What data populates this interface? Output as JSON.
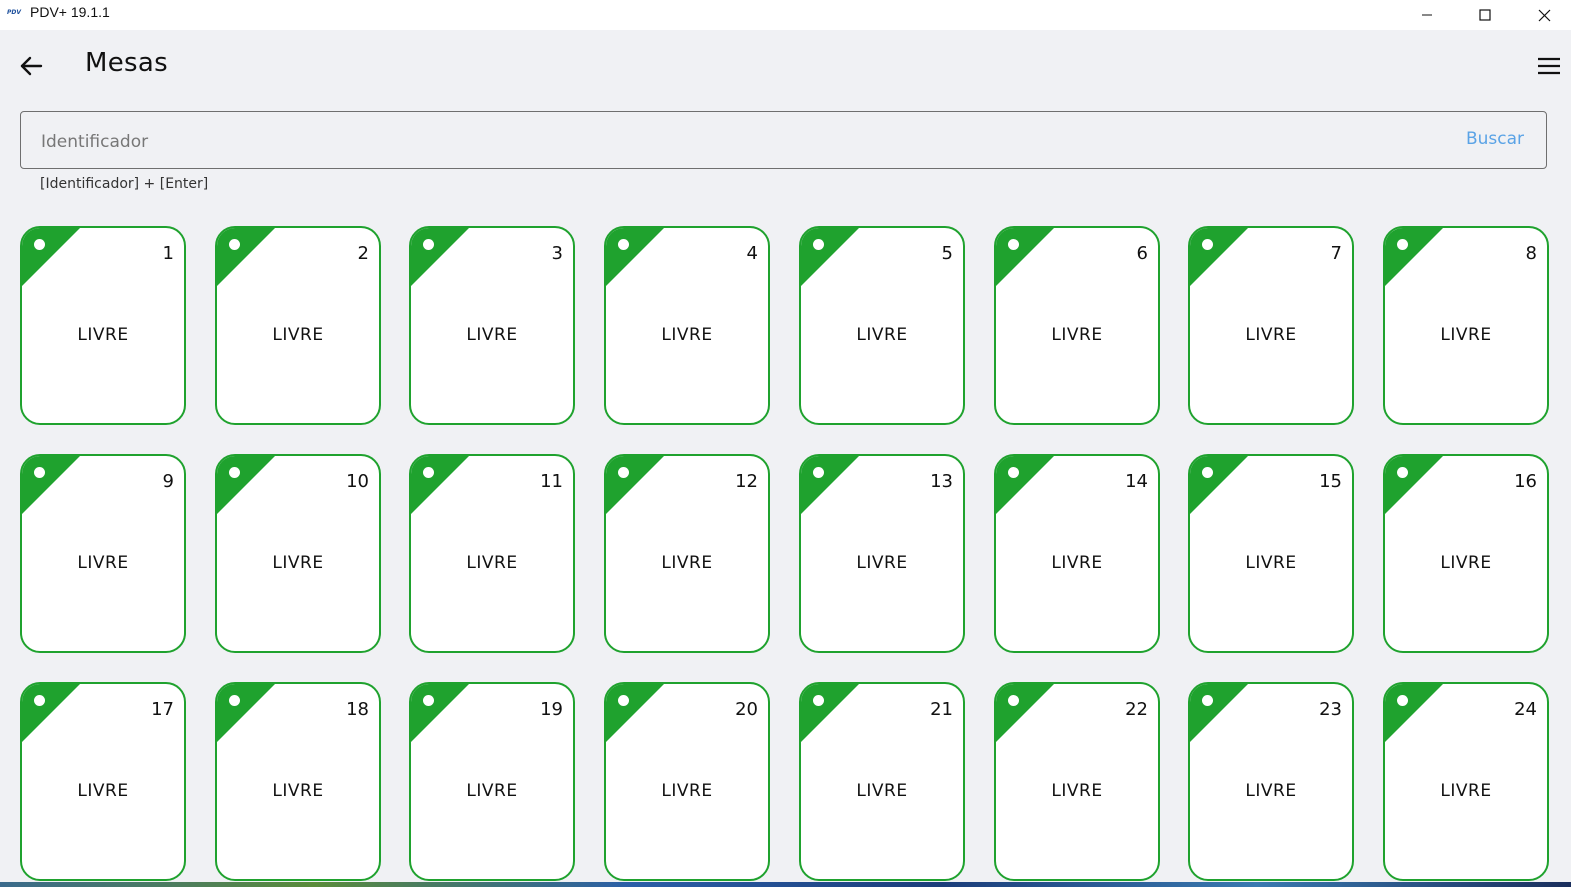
{
  "window": {
    "logo_text": "PDV",
    "title": "PDV+ 19.1.1"
  },
  "header": {
    "title": "Mesas"
  },
  "search": {
    "placeholder": "Identificador",
    "value": "",
    "button_label": "Buscar",
    "hint": "[Identificador] + [Enter]"
  },
  "colors": {
    "free_status": "#1fa22e",
    "search_button": "#5aa3e6",
    "background": "#f0f1f4"
  },
  "tables": [
    {
      "number": "1",
      "status": "LIVRE"
    },
    {
      "number": "2",
      "status": "LIVRE"
    },
    {
      "number": "3",
      "status": "LIVRE"
    },
    {
      "number": "4",
      "status": "LIVRE"
    },
    {
      "number": "5",
      "status": "LIVRE"
    },
    {
      "number": "6",
      "status": "LIVRE"
    },
    {
      "number": "7",
      "status": "LIVRE"
    },
    {
      "number": "8",
      "status": "LIVRE"
    },
    {
      "number": "9",
      "status": "LIVRE"
    },
    {
      "number": "10",
      "status": "LIVRE"
    },
    {
      "number": "11",
      "status": "LIVRE"
    },
    {
      "number": "12",
      "status": "LIVRE"
    },
    {
      "number": "13",
      "status": "LIVRE"
    },
    {
      "number": "14",
      "status": "LIVRE"
    },
    {
      "number": "15",
      "status": "LIVRE"
    },
    {
      "number": "16",
      "status": "LIVRE"
    },
    {
      "number": "17",
      "status": "LIVRE"
    },
    {
      "number": "18",
      "status": "LIVRE"
    },
    {
      "number": "19",
      "status": "LIVRE"
    },
    {
      "number": "20",
      "status": "LIVRE"
    },
    {
      "number": "21",
      "status": "LIVRE"
    },
    {
      "number": "22",
      "status": "LIVRE"
    },
    {
      "number": "23",
      "status": "LIVRE"
    },
    {
      "number": "24",
      "status": "LIVRE"
    }
  ]
}
